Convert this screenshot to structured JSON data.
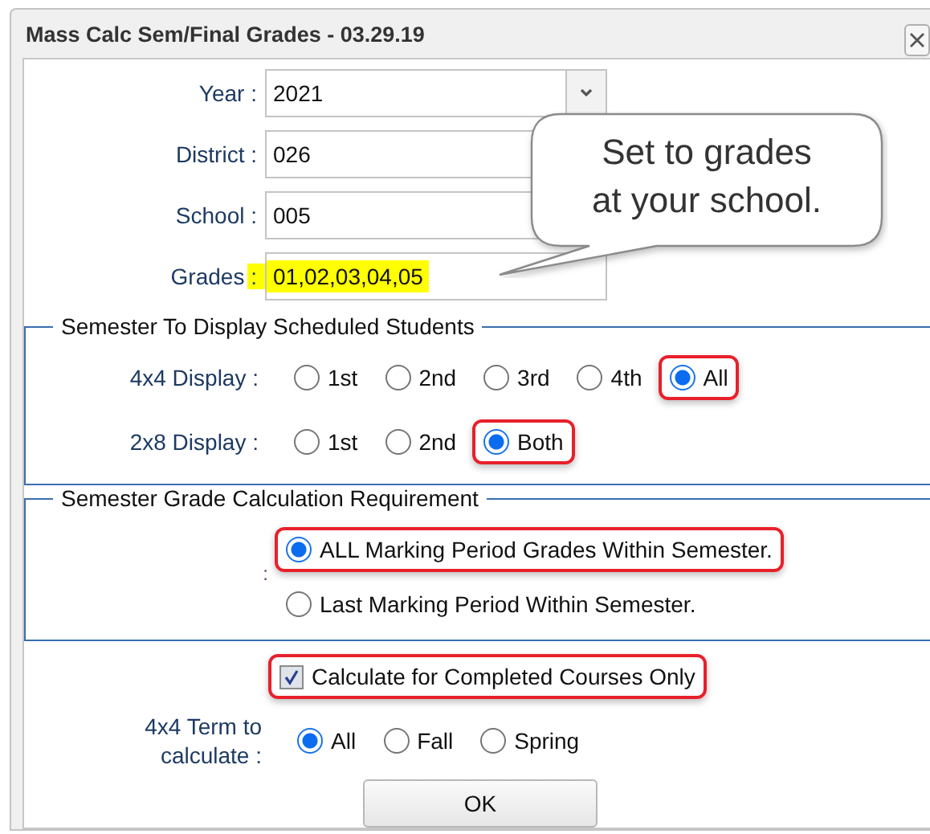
{
  "window": {
    "title": "Mass Calc Sem/Final Grades - 03.29.19"
  },
  "fields": [
    {
      "label": "Year :",
      "value": "2021",
      "kind": "dropdown",
      "highlighted": false
    },
    {
      "label": "District :",
      "value": "026",
      "kind": "text",
      "highlighted": false,
      "covered": true
    },
    {
      "label": "School :",
      "value": "005",
      "kind": "text",
      "highlighted": false,
      "covered": true
    },
    {
      "label": "Grades :",
      "value": "01,02,03,04,05",
      "kind": "text",
      "highlighted": true
    }
  ],
  "callout": {
    "text": "Set to grades\nat your school."
  },
  "sections": [
    {
      "legend": "Semester To Display Scheduled Students",
      "groups": [
        {
          "label": "4x4 Display :",
          "kind": "inline",
          "options": [
            {
              "label": "1st",
              "selected": false,
              "highlighted": false
            },
            {
              "label": "2nd",
              "selected": false,
              "highlighted": false
            },
            {
              "label": "3rd",
              "selected": false,
              "highlighted": false
            },
            {
              "label": "4th",
              "selected": false,
              "highlighted": false
            },
            {
              "label": "All",
              "selected": true,
              "highlighted": true
            }
          ]
        },
        {
          "label": "2x8 Display :",
          "kind": "inline",
          "options": [
            {
              "label": "1st",
              "selected": false,
              "highlighted": false
            },
            {
              "label": "2nd",
              "selected": false,
              "highlighted": false
            },
            {
              "label": "Both",
              "selected": true,
              "highlighted": true
            }
          ]
        }
      ]
    },
    {
      "legend": "Semester Grade Calculation Requirement",
      "groups": [
        {
          "label": ":",
          "kind": "stacked",
          "options": [
            {
              "label": "ALL Marking Period Grades Within Semester.",
              "selected": true,
              "highlighted": true
            },
            {
              "label": "Last Marking Period Within Semester.",
              "selected": false,
              "highlighted": false
            }
          ]
        }
      ]
    }
  ],
  "completed_only": {
    "label": "Calculate for Completed Courses Only",
    "checked": true,
    "highlighted": true
  },
  "term": {
    "label": "4x4 Term to calculate :",
    "options": [
      {
        "label": "All",
        "selected": true
      },
      {
        "label": "Fall",
        "selected": false
      },
      {
        "label": "Spring",
        "selected": false
      }
    ]
  },
  "ok_button": "OK"
}
